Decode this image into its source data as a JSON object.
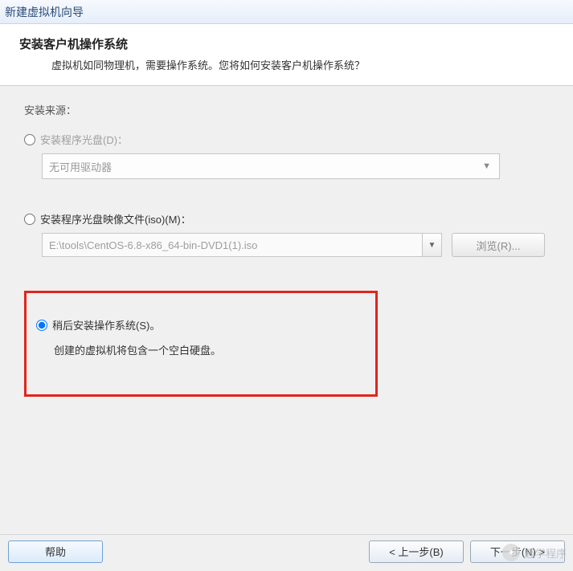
{
  "window": {
    "title": "新建虚拟机向导"
  },
  "header": {
    "title": "安装客户机操作系统",
    "description": "虚拟机如同物理机，需要操作系统。您将如何安装客户机操作系统？"
  },
  "source": {
    "legend": "安装来源：",
    "options": {
      "disc": {
        "label": "安装程序光盘(D)：",
        "selected": false,
        "drive_text": "无可用驱动器"
      },
      "iso": {
        "label": "安装程序光盘映像文件(iso)(M)：",
        "selected": false,
        "path": "E:\\tools\\CentOS-6.8-x86_64-bin-DVD1(1).iso",
        "browse_label": "浏览(R)..."
      },
      "later": {
        "label": "稍后安装操作系统(S)。",
        "selected": true,
        "description": "创建的虚拟机将包含一个空白硬盘。"
      }
    }
  },
  "footer": {
    "help": "帮助",
    "back": "< 上一步(B)",
    "next": "下一步(N) >"
  },
  "watermark": {
    "text": "趣学程序"
  }
}
